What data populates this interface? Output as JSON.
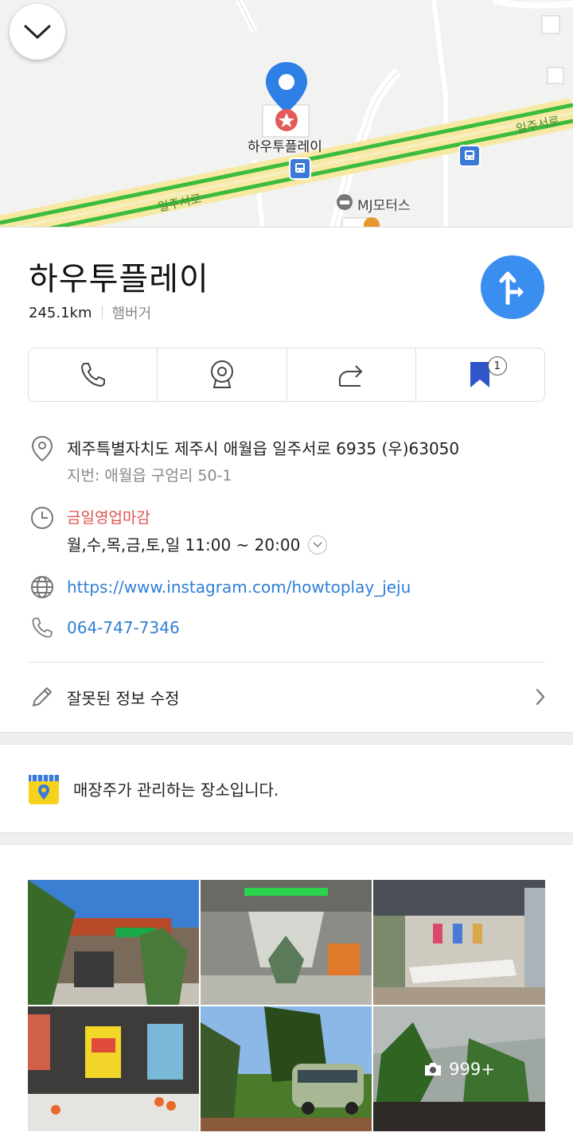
{
  "map": {
    "place_label": "하우투플레이",
    "poi_label": "MJ모터스",
    "road_label_left": "일주서로",
    "road_label_right": "일주서로"
  },
  "place": {
    "title": "하우투플레이",
    "distance": "245.1km",
    "category": "햄버거"
  },
  "actions": {
    "bookmark_count": "1"
  },
  "info": {
    "address": "제주특별자치도 제주시 애월읍 일주서로 6935 (우)63050",
    "lot_address": "지번: 애월읍 구엄리 50-1",
    "status": "금일영업마감",
    "hours": "월,수,목,금,토,일 11:00 ~ 20:00",
    "website": "https://www.instagram.com/howtoplay_jeju",
    "phone": "064-747-7346",
    "edit_label": "잘못된 정보 수정"
  },
  "owner": {
    "text": "매장주가 관리하는 장소입니다."
  },
  "photos": {
    "more_count": "999+"
  },
  "colors": {
    "accent": "#3a8ef0",
    "link": "#2e7fd6",
    "closed": "#e0524e",
    "road_green": "#3dbb3d"
  }
}
